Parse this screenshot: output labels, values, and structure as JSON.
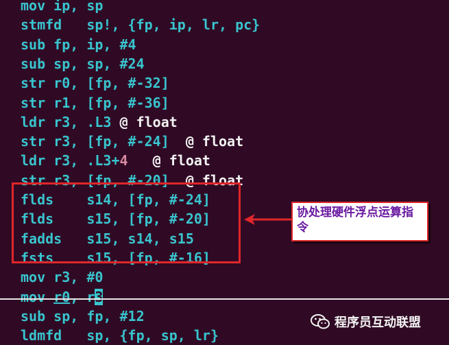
{
  "terminal": {
    "lines": [
      {
        "label": "mov-ip-sp",
        "tokens": [
          {
            "text": "mov ip, sp"
          }
        ]
      },
      {
        "label": "stmfd",
        "tokens": [
          {
            "text": "stmfd   sp!, {fp, ip, lr, pc}"
          }
        ]
      },
      {
        "label": "sub-fp",
        "tokens": [
          {
            "text": "sub fp, ip, #4"
          }
        ]
      },
      {
        "label": "sub-sp",
        "tokens": [
          {
            "text": "sub sp, sp, #24"
          }
        ]
      },
      {
        "label": "str-r0",
        "tokens": [
          {
            "text": "str r0, [fp, #-32]"
          }
        ]
      },
      {
        "label": "str-r1",
        "tokens": [
          {
            "text": "str r1, [fp, #-36]"
          }
        ]
      },
      {
        "label": "ldr-r3-l3",
        "tokens": [
          {
            "text": "ldr r3, .L3 "
          },
          {
            "text": "@ float",
            "style": "white"
          }
        ]
      },
      {
        "label": "str-r3-24",
        "tokens": [
          {
            "text": "str r3, [fp, #-24]  "
          },
          {
            "text": "@ float",
            "style": "white"
          }
        ]
      },
      {
        "label": "ldr-r3-l3-4",
        "tokens": [
          {
            "text": "ldr r3, .L3+"
          },
          {
            "text": "4",
            "style": "num"
          },
          {
            "text": "   "
          },
          {
            "text": "@ float",
            "style": "white"
          }
        ]
      },
      {
        "label": "str-r3-20",
        "tokens": [
          {
            "text": "str r3, [fp, #-20]  "
          },
          {
            "text": "@ float",
            "style": "white"
          }
        ]
      },
      {
        "label": "flds-s14",
        "tokens": [
          {
            "text": "flds    s14, [fp, #-24]"
          }
        ]
      },
      {
        "label": "flds-s15",
        "tokens": [
          {
            "text": "flds    s15, [fp, #-20]"
          }
        ]
      },
      {
        "label": "fadds",
        "tokens": [
          {
            "text": "fadds   s15, s14, s15"
          }
        ]
      },
      {
        "label": "fsts",
        "tokens": [
          {
            "text": "fsts    s15, [fp, #-16]"
          }
        ]
      },
      {
        "label": "mov-r3-0",
        "tokens": [
          {
            "text": "mov r3, #0"
          }
        ]
      },
      {
        "label": "mov-r0-r3",
        "tokens": [
          {
            "text": "mov "
          },
          {
            "text": "r0",
            "style": "under"
          },
          {
            "text": ", r"
          },
          {
            "text": "3",
            "style": "cursor"
          }
        ]
      },
      {
        "label": "sub-sp-fp",
        "tokens": [
          {
            "text": "sub sp, fp, #12"
          }
        ]
      },
      {
        "label": "ldmfd",
        "tokens": [
          {
            "text": "ldmfd   sp, {fp, sp, lr}"
          }
        ]
      }
    ]
  },
  "annotation": {
    "callout_text": "协处理硬件浮点运算指令"
  },
  "watermark": {
    "icon": "wechat-icon",
    "text": "程序员互动联盟"
  },
  "colors": {
    "background": "#300a24",
    "code": "#39c5cf",
    "comment": "#f2f2f2",
    "number": "#d88aa0",
    "highlight": "#e0262a",
    "callout_text": "#6a1aa0"
  }
}
